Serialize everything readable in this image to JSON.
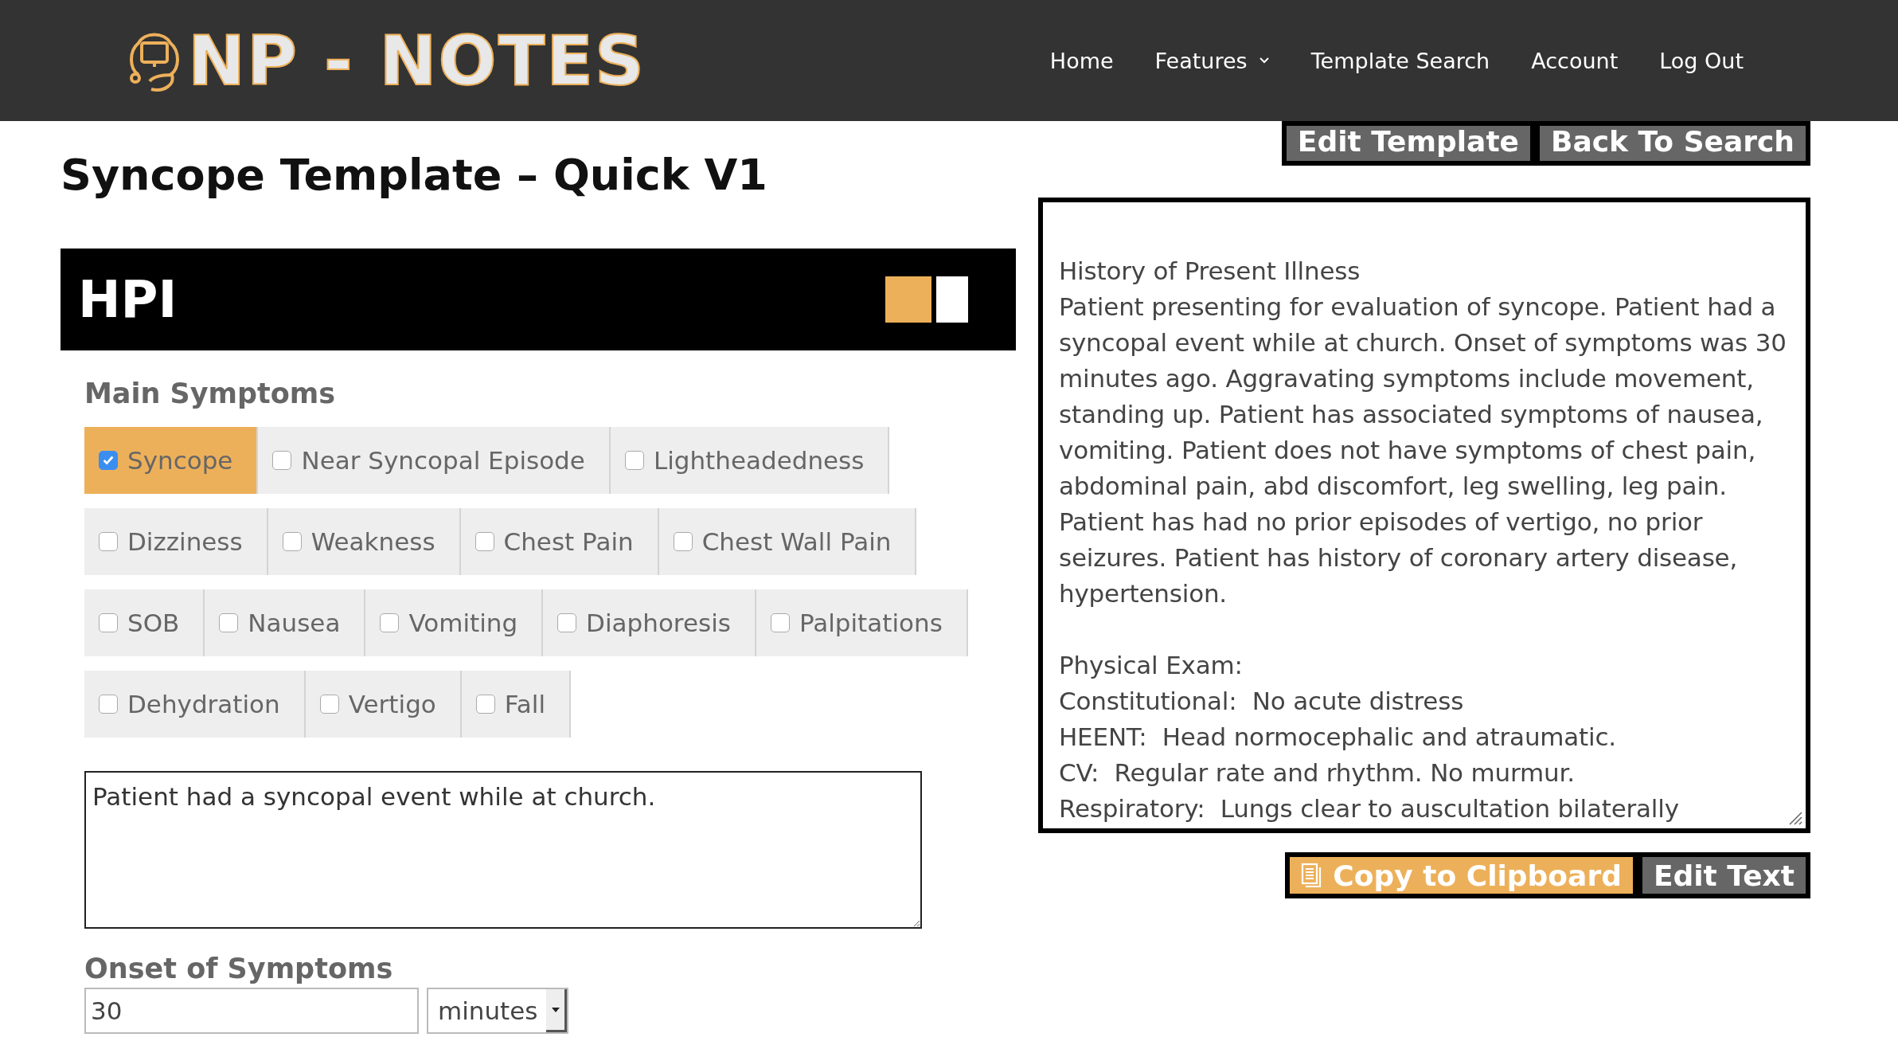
{
  "nav": {
    "logo": "NP - NOTES",
    "links": [
      {
        "label": "Home",
        "kind": "link"
      },
      {
        "label": "Features",
        "kind": "dropdown"
      },
      {
        "label": "Template Search",
        "kind": "link"
      },
      {
        "label": "Account",
        "kind": "link"
      },
      {
        "label": "Log Out",
        "kind": "link"
      }
    ]
  },
  "page_title": "Syncope Template – Quick V1",
  "top_buttons": [
    "Edit Template",
    "Back To Search"
  ],
  "section": {
    "title": "HPI"
  },
  "main_symptoms": {
    "label": "Main Symptoms",
    "rows": [
      [
        {
          "label": "Syncope",
          "checked": true
        },
        {
          "label": "Near Syncopal Episode",
          "checked": false
        },
        {
          "label": "Lightheadedness",
          "checked": false
        }
      ],
      [
        {
          "label": "Dizziness",
          "checked": false
        },
        {
          "label": "Weakness",
          "checked": false
        },
        {
          "label": "Chest Pain",
          "checked": false
        },
        {
          "label": "Chest Wall Pain",
          "checked": false
        }
      ],
      [
        {
          "label": "SOB",
          "checked": false
        },
        {
          "label": "Nausea",
          "checked": false
        },
        {
          "label": "Vomiting",
          "checked": false
        },
        {
          "label": "Diaphoresis",
          "checked": false
        },
        {
          "label": "Palpitations",
          "checked": false
        }
      ],
      [
        {
          "label": "Dehydration",
          "checked": false
        },
        {
          "label": "Vertigo",
          "checked": false
        },
        {
          "label": "Fall",
          "checked": false
        }
      ]
    ]
  },
  "note": {
    "value": "Patient had a syncopal event while at church."
  },
  "onset": {
    "label": "Onset of Symptoms",
    "value": "30",
    "unit": "minutes"
  },
  "output": {
    "sections": [
      {
        "lines": [
          "History of Present Illness",
          "Patient presenting for evaluation of syncope. Patient had a syncopal event while at church. Onset of symptoms was 30 minutes ago. Aggravating symptoms include movement, standing up. Patient has associated symptoms of nausea, vomiting. Patient does not have symptoms of chest pain, abdominal pain, abd discomfort, leg swelling, leg pain. Patient has had no prior episodes of vertigo, no prior seizures. Patient has history of coronary artery disease, hypertension."
        ]
      },
      {
        "lines": [
          "Physical Exam:",
          "Constitutional:  No acute distress",
          "HEENT:  Head normocephalic and atraumatic.",
          "CV:  Regular rate and rhythm. No murmur.",
          "Respiratory:  Lungs clear to auscultation bilaterally"
        ]
      }
    ]
  },
  "bottom_buttons": [
    {
      "label": "Copy to Clipboard",
      "kind": "copy"
    },
    {
      "label": "Edit Text",
      "kind": "plain"
    }
  ]
}
